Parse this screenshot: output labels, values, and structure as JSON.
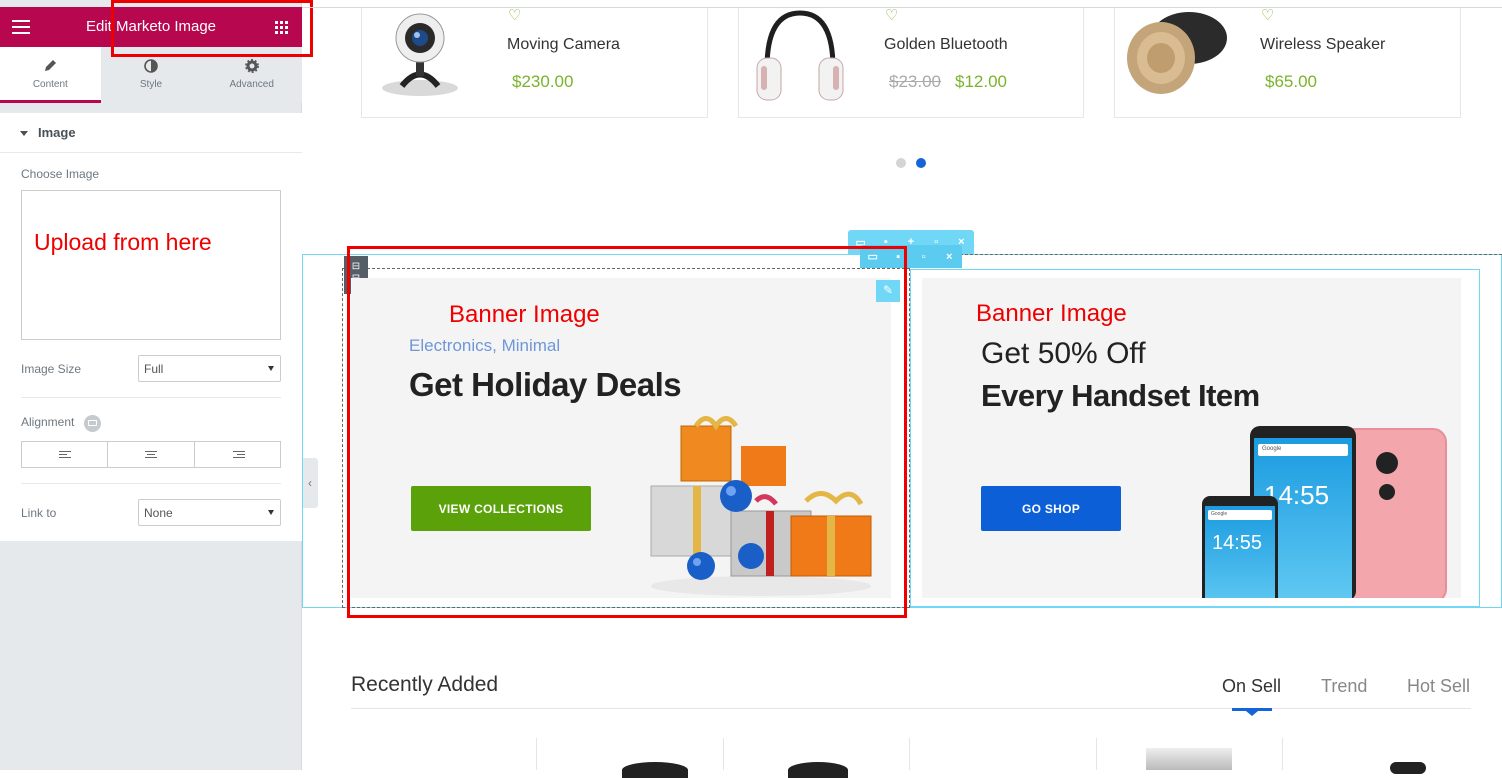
{
  "panel": {
    "title": "Edit Marketo Image",
    "tabs": [
      {
        "label": "Content",
        "icon": "pencil-icon"
      },
      {
        "label": "Style",
        "icon": "contrast-icon"
      },
      {
        "label": "Advanced",
        "icon": "gear-icon"
      }
    ],
    "section_title": "Image",
    "choose_image_label": "Choose Image",
    "upload_note": "Upload from here",
    "image_size_label": "Image Size",
    "image_size_value": "Full",
    "alignment_label": "Alignment",
    "link_label": "Link to",
    "link_value": "None",
    "accent_color": "#b7084f"
  },
  "products": [
    {
      "name": "Moving Camera",
      "price": "$230.00",
      "old_price": ""
    },
    {
      "name": "Golden Bluetooth",
      "price": "$12.00",
      "old_price": "$23.00"
    },
    {
      "name": "Wireless Speaker",
      "price": "$65.00",
      "old_price": ""
    }
  ],
  "carousel": {
    "active_dot": 2,
    "dot_count": 2
  },
  "banners": [
    {
      "annotation": "Banner Image",
      "subtitle": "Electronics, Minimal",
      "heading": "Get Holiday Deals",
      "button": "VIEW COLLECTIONS",
      "button_color": "#5aa10a"
    },
    {
      "annotation": "Banner Image",
      "heading_light": "Get 50% Off",
      "heading": "Every Handset Item",
      "button": "GO SHOP",
      "button_color": "#0c5fd6",
      "phone_time_big": "14:55",
      "phone_time_small": "14:55",
      "phone_brand": "Google"
    }
  ],
  "recent": {
    "title": "Recently Added",
    "tabs": [
      "On Sell",
      "Trend",
      "Hot Sell"
    ],
    "active_tab": "On Sell"
  },
  "editor_toolbar_color": "#71d7f7"
}
